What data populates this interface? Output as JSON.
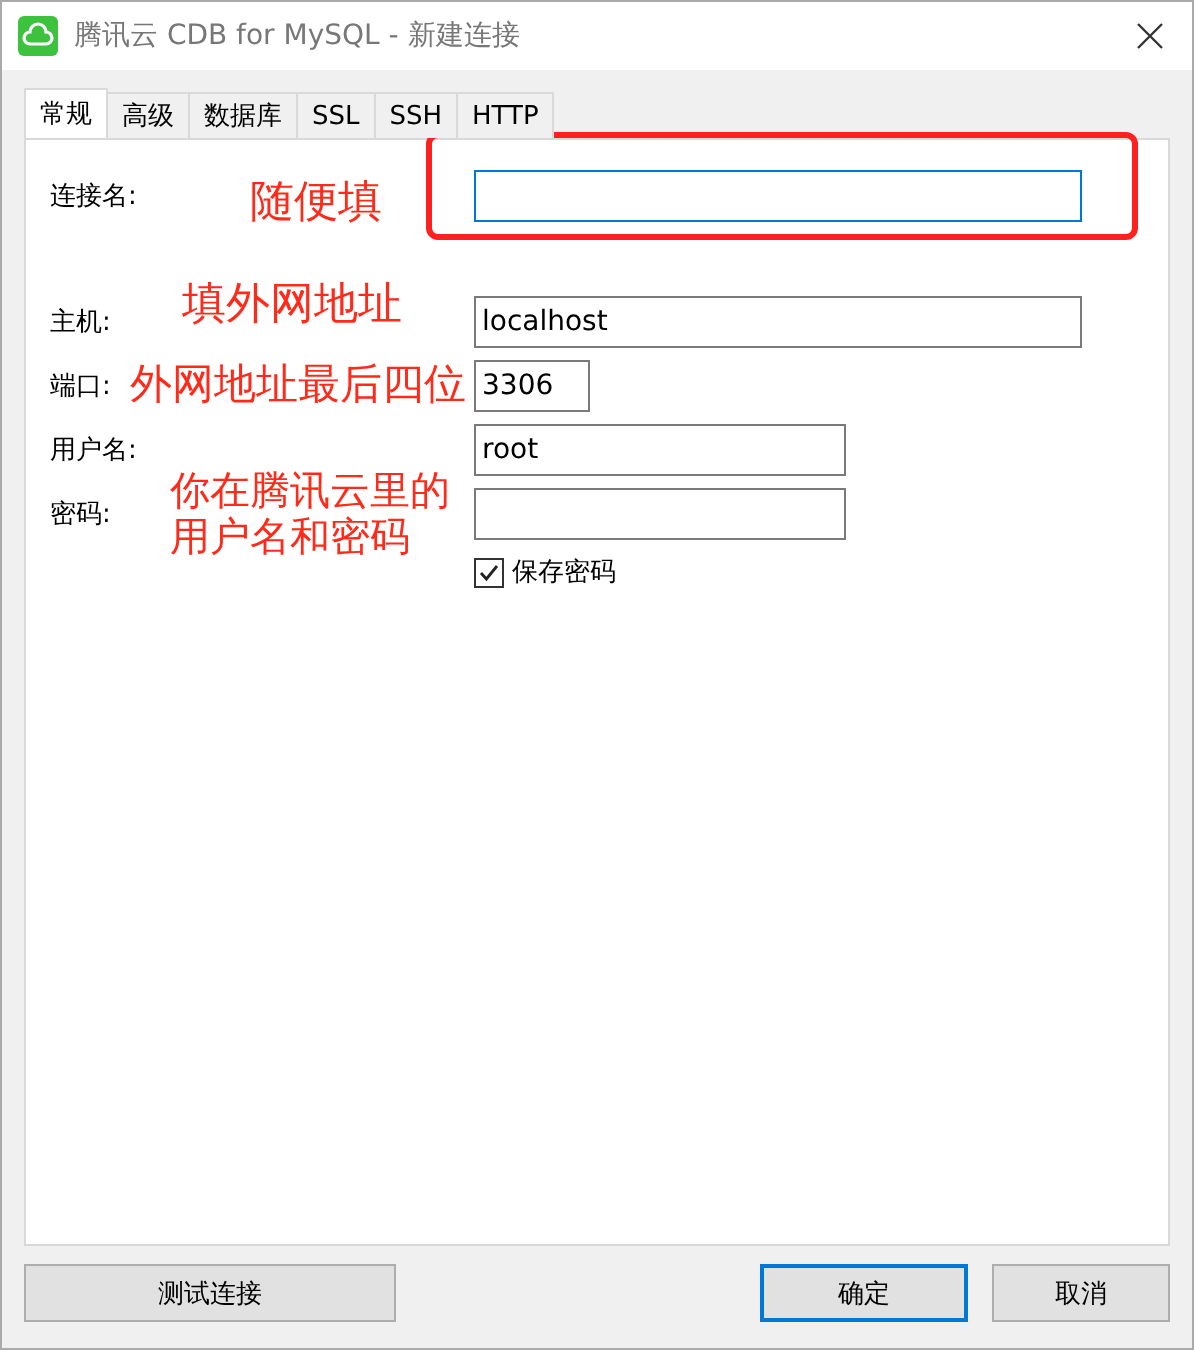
{
  "window": {
    "title": "腾讯云 CDB for MySQL - 新建连接"
  },
  "tabs": [
    {
      "label": "常规",
      "selected": true
    },
    {
      "label": "高级",
      "selected": false
    },
    {
      "label": "数据库",
      "selected": false
    },
    {
      "label": "SSL",
      "selected": false
    },
    {
      "label": "SSH",
      "selected": false
    },
    {
      "label": "HTTP",
      "selected": false
    }
  ],
  "fields": [
    {
      "label": "连接名:",
      "focused": true
    },
    {
      "label": "主机:",
      "value": "localhost",
      "focused": false
    },
    {
      "label": "端口:",
      "value": "3306",
      "focused": false
    },
    {
      "label": "用户名:",
      "value": "root",
      "focused": false
    },
    {
      "label": "密码:",
      "focused": false
    }
  ],
  "save_password": {
    "label": "保存密码",
    "checked": true
  },
  "buttons": [
    {
      "label": "测试连接",
      "default": false
    },
    {
      "label": "确定",
      "default": true
    },
    {
      "label": "取消",
      "default": false
    }
  ],
  "annotations": [
    {
      "text": "随便填"
    },
    {
      "text": "填外网地址"
    },
    {
      "text": "外网地址最后四位"
    },
    {
      "text": "你在腾讯云里的用户名和密码"
    }
  ]
}
